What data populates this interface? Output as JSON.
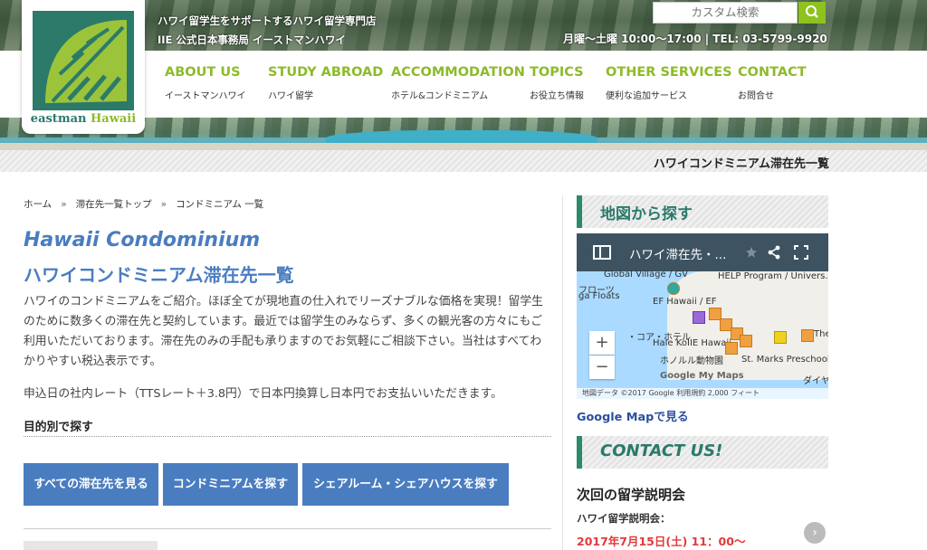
{
  "header": {
    "tagline1": "ハワイ留学生をサポートするハワイ留学専門店",
    "tagline2": "IIE 公式日本事務局 イーストマンハワイ",
    "brand_a": "eastman",
    "brand_b": "Hawaii",
    "search_placeholder": "カスタム検索",
    "hours": "月曜〜土曜 10:00〜17:00 | TEL: 03-5799-9920",
    "page_strip_title": "ハワイコンドミニアム滞在先一覧"
  },
  "nav": [
    {
      "en": "ABOUT US",
      "jp": "イーストマンハワイ"
    },
    {
      "en": "STUDY ABROAD",
      "jp": "ハワイ留学"
    },
    {
      "en": "ACCOMMODATION",
      "jp": "ホテル&コンドミニアム"
    },
    {
      "en": "TOPICS",
      "jp": "お役立ち情報"
    },
    {
      "en": "OTHER SERVICES",
      "jp": "便利な追加サービス"
    },
    {
      "en": "CONTACT",
      "jp": "お問合せ"
    }
  ],
  "breadcrumb": [
    "ホーム",
    "滞在先一覧トップ",
    "コンドミニアム 一覧"
  ],
  "breadcrumb_sep": "»",
  "main": {
    "title_en": "Hawaii Condominium",
    "title_jp": "ハワイコンドミニアム滞在先一覧",
    "intro": "ハワイのコンドミニアムをご紹介。ほぼ全てが現地直の仕入れでリーズナブルな価格を実現！留学生のために数多くの滞在先と契約しています。最近では留学生のみならず、多くの観光客の方々にもご利用いただいております。滞在先のみの手配も承りますのでお気軽にご相談下さい。当社はすべてわかりやすい税込表示です。",
    "note": "申込日の社内レート（TTSレート＋3.8円）で日本円換算し日本円でお支払いいただきます。",
    "purpose_heading": "目的別で探す",
    "buttons": [
      "すべての滞在先を見る",
      "コンドミニアムを探す",
      "シェアルーム・シェアハウスを探す"
    ]
  },
  "sidebar": {
    "map_heading": "地図から探す",
    "map_title": "ハワイ滞在先・...",
    "map_labels": [
      "Global Village / GV",
      "HELP Program / Univers...",
      "フローツ",
      "ga Floats",
      "EF Hawaii / EF",
      "・コア・ホテル",
      "Hale Ko",
      "IIE Hawaii",
      "ホノルル動物園",
      "St. Marks Preschool",
      "The C",
      "ダイヤ",
      "Google My Maps"
    ],
    "map_footer": "地図データ ©2017 Google   利用規約   2,000 フィート",
    "zoom_in": "+",
    "zoom_out": "−",
    "gmap_link": "Google Mapで見る",
    "contact_heading": "CONTACT US!",
    "seminar_title": "次回の留学説明会",
    "seminar_sub": "ハワイ留学説明会：",
    "seminar_date": "2017年7月15日(土) 11：00〜"
  },
  "colors": {
    "accent_green": "#8dbb2a",
    "title_blue": "#4a7dc0",
    "button_blue": "#4a7dc0",
    "side_green": "#2b7a6a",
    "date_red": "#e23a3a"
  },
  "icons": [
    "search-icon",
    "sidebar-toggle-icon",
    "star-icon",
    "share-icon",
    "fullscreen-icon",
    "chevron-right-icon"
  ]
}
